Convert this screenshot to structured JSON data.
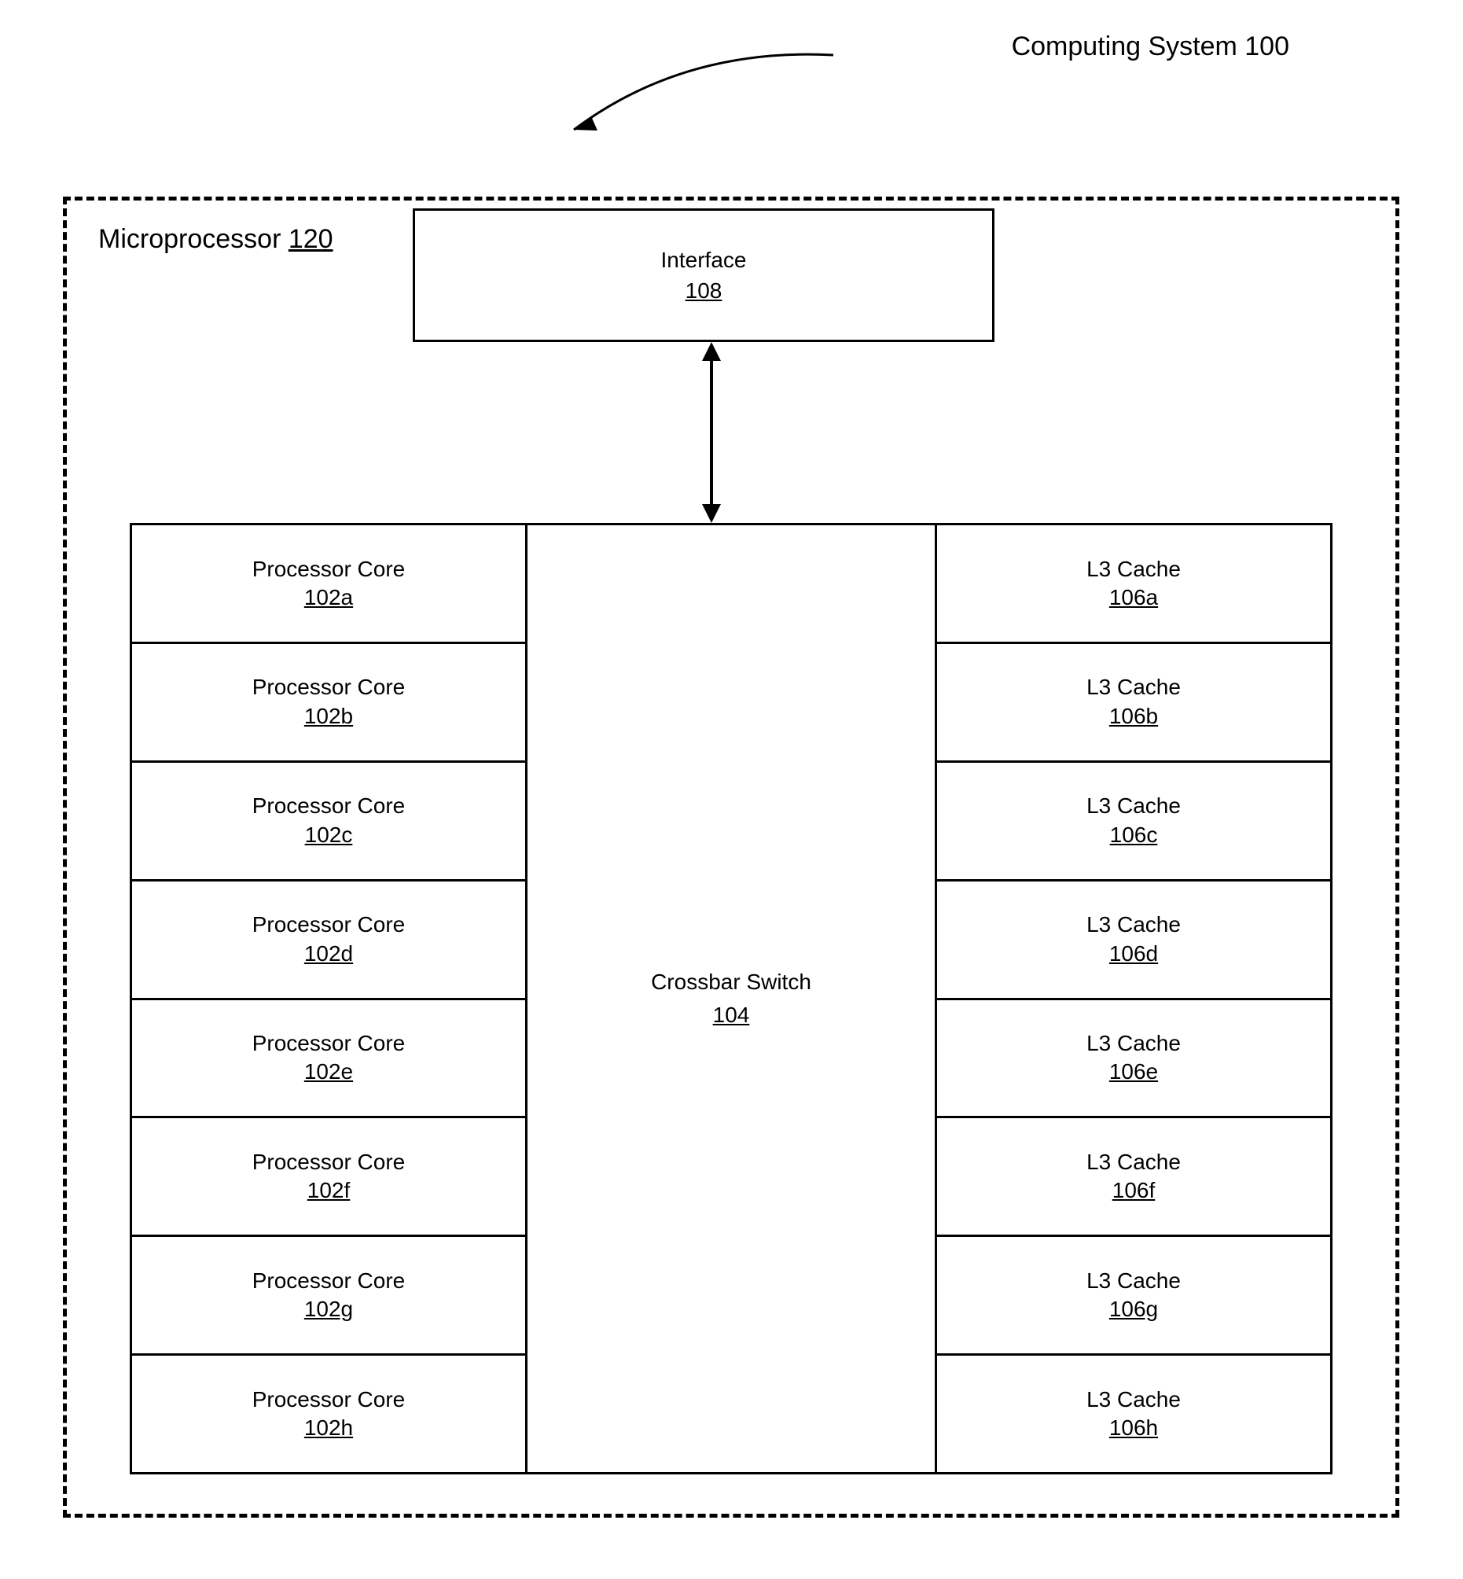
{
  "title": "Computing System 100",
  "microprocessor": {
    "label": "Microprocessor",
    "ref": "120"
  },
  "interface": {
    "label": "Interface",
    "ref": "108"
  },
  "crossbar": {
    "label": "Crossbar Switch",
    "ref": "104"
  },
  "cores": [
    {
      "label": "Processor Core",
      "ref": "102a"
    },
    {
      "label": "Processor Core",
      "ref": "102b"
    },
    {
      "label": "Processor Core",
      "ref": "102c"
    },
    {
      "label": "Processor Core",
      "ref": "102d"
    },
    {
      "label": "Processor Core",
      "ref": "102e"
    },
    {
      "label": "Processor Core",
      "ref": "102f"
    },
    {
      "label": "Processor Core",
      "ref": "102g"
    },
    {
      "label": "Processor Core",
      "ref": "102h"
    }
  ],
  "caches": [
    {
      "label": "L3 Cache",
      "ref": "106a"
    },
    {
      "label": "L3 Cache",
      "ref": "106b"
    },
    {
      "label": "L3 Cache",
      "ref": "106c"
    },
    {
      "label": "L3 Cache",
      "ref": "106d"
    },
    {
      "label": "L3 Cache",
      "ref": "106e"
    },
    {
      "label": "L3 Cache",
      "ref": "106f"
    },
    {
      "label": "L3 Cache",
      "ref": "106g"
    },
    {
      "label": "L3 Cache",
      "ref": "106h"
    }
  ]
}
